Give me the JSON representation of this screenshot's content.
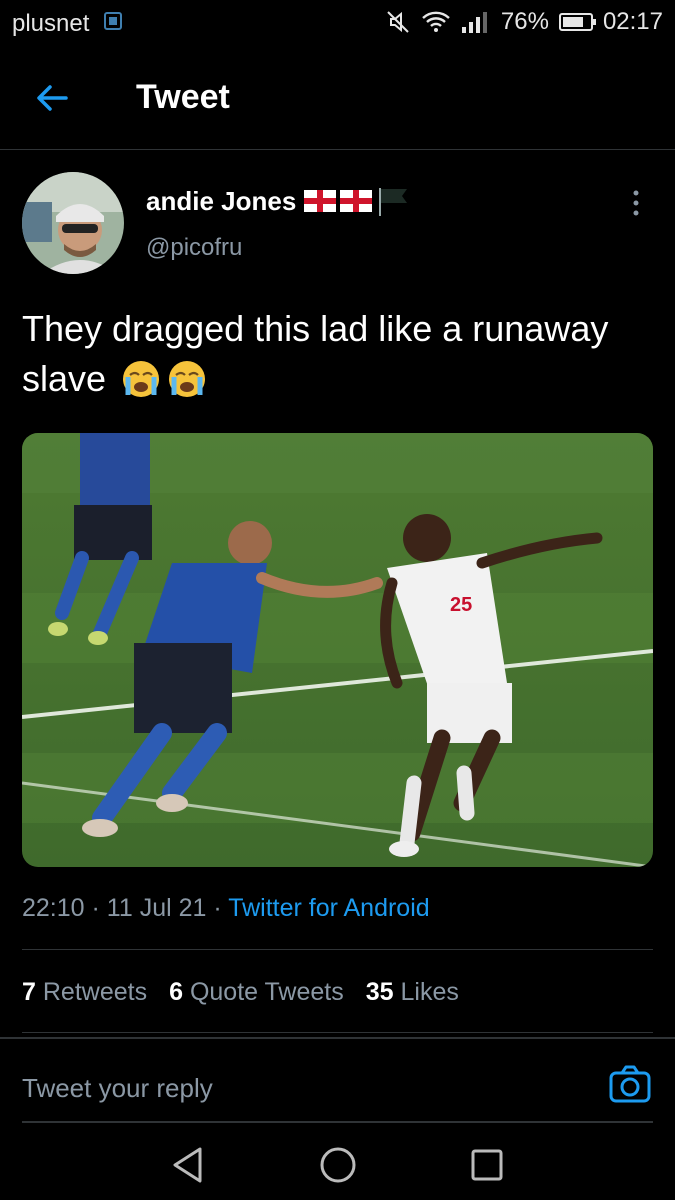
{
  "status_bar": {
    "carrier": "plusnet",
    "battery": "76%",
    "time": "02:17",
    "battery_level": 0.76
  },
  "header": {
    "title": "Tweet"
  },
  "tweet": {
    "author": {
      "display_name": "andie Jones",
      "handle": "@picofru"
    },
    "text": "They dragged this lad like a runaway slave",
    "time": "22:10",
    "date": "11 Jul 21",
    "source": "Twitter for Android",
    "stats": {
      "retweets_count": "7",
      "retweets_label": "Retweets",
      "quotes_count": "6",
      "quotes_label": "Quote Tweets",
      "likes_count": "35",
      "likes_label": "Likes"
    }
  },
  "reply": {
    "placeholder": "Tweet your reply"
  },
  "colors": {
    "accent": "#1d9bf0",
    "secondary_text": "#8b98a5",
    "divider": "#2f3336"
  }
}
